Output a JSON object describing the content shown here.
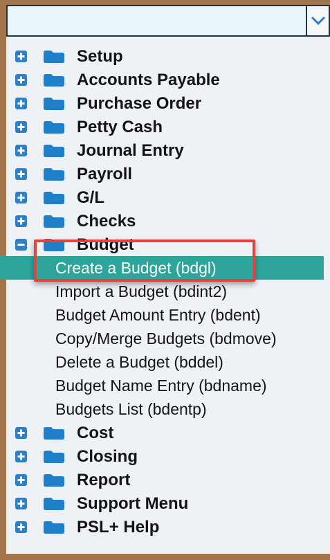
{
  "combo": {
    "value": "",
    "icon": "chevron-down-icon"
  },
  "tree": {
    "categories_before": [
      {
        "label": "Setup",
        "expanded": false
      },
      {
        "label": "Accounts Payable",
        "expanded": false
      },
      {
        "label": "Purchase Order",
        "expanded": false
      },
      {
        "label": "Petty Cash",
        "expanded": false
      },
      {
        "label": "Journal Entry",
        "expanded": false
      },
      {
        "label": "Payroll",
        "expanded": false
      },
      {
        "label": "G/L",
        "expanded": false
      },
      {
        "label": "Checks",
        "expanded": false
      }
    ],
    "budget": {
      "label": "Budget",
      "expanded": true,
      "children": [
        {
          "label": "Create a Budget (bdgl)",
          "selected": true
        },
        {
          "label": "Import a Budget (bdint2)",
          "selected": false
        },
        {
          "label": "Budget Amount Entry (bdent)",
          "selected": false
        },
        {
          "label": "Copy/Merge Budgets (bdmove)",
          "selected": false
        },
        {
          "label": "Delete a Budget (bddel)",
          "selected": false
        },
        {
          "label": "Budget Name Entry (bdname)",
          "selected": false
        },
        {
          "label": "Budgets List (bdentp)",
          "selected": false
        }
      ]
    },
    "categories_after": [
      {
        "label": "Cost",
        "expanded": false
      },
      {
        "label": "Closing",
        "expanded": false
      },
      {
        "label": "Report",
        "expanded": false
      },
      {
        "label": "Support Menu",
        "expanded": false
      },
      {
        "label": "PSL+ Help",
        "expanded": false
      }
    ]
  },
  "colors": {
    "frame": "#a3754a",
    "panel": "#eef2f6",
    "expander": "#2f7fc6",
    "folder": "#1f7fc8",
    "selection": "#2ea59a",
    "highlight_border": "#e2433c"
  }
}
